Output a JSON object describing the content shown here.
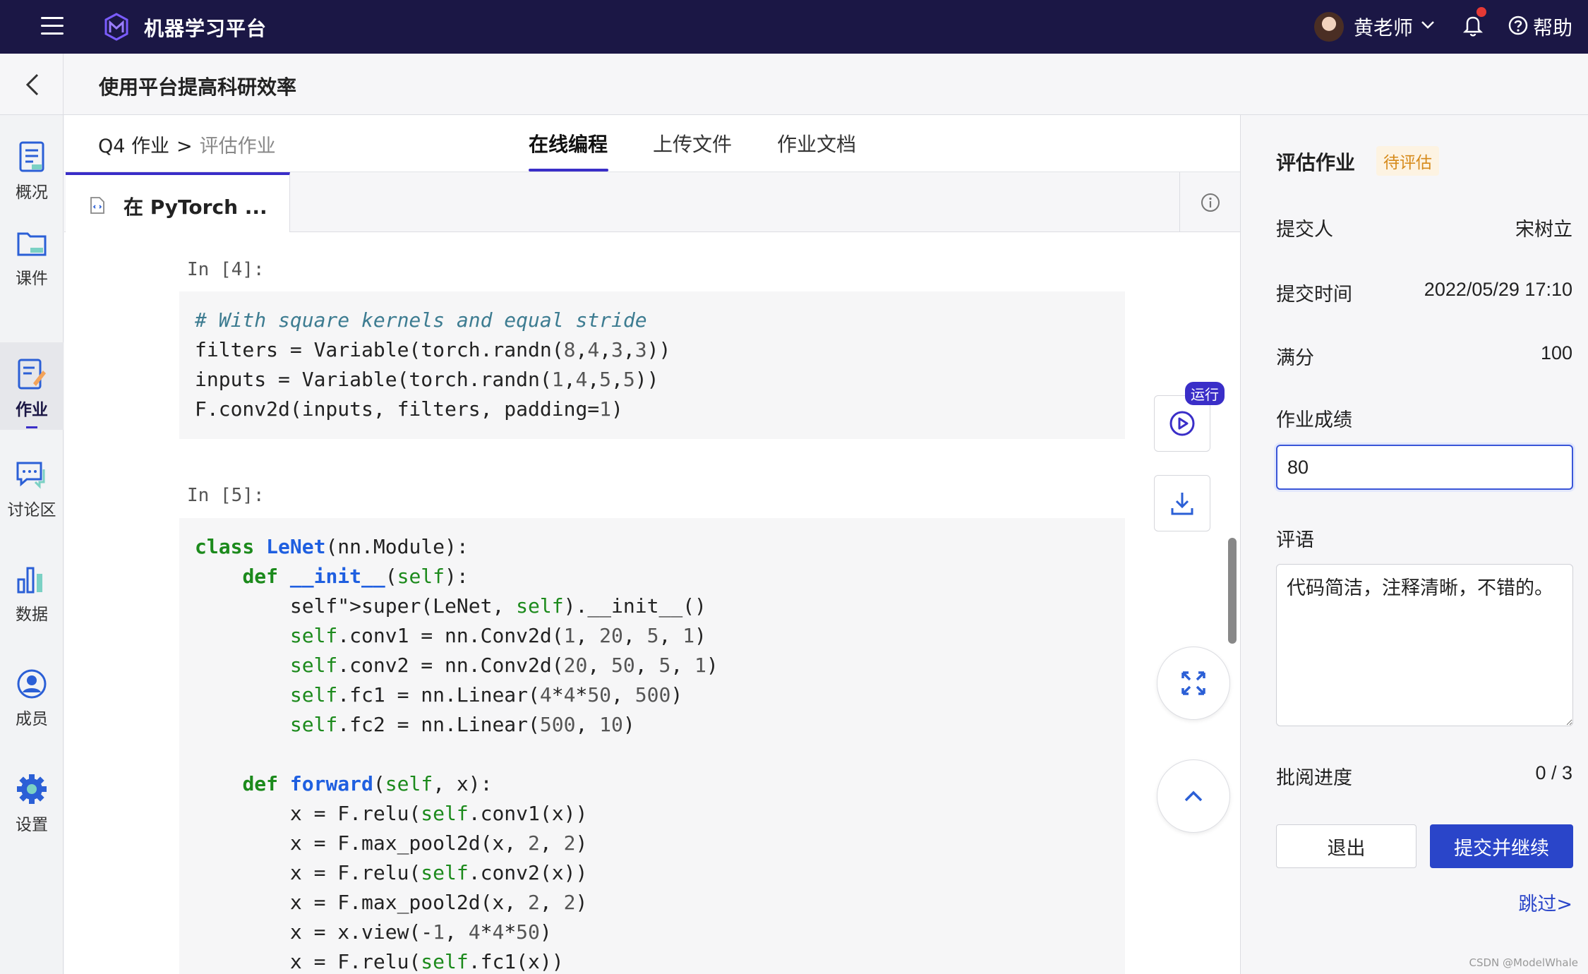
{
  "topbar": {
    "app_title": "机器学习平台",
    "user_name": "黄老师",
    "help_label": "帮助"
  },
  "header": {
    "page_title": "使用平台提高科研效率"
  },
  "sidebar": {
    "items": [
      {
        "label": "概况",
        "icon": "overview-icon"
      },
      {
        "label": "课件",
        "icon": "folder-icon"
      },
      {
        "label": "作业",
        "icon": "assignment-icon",
        "active": true
      },
      {
        "label": "讨论区",
        "icon": "discussion-icon"
      },
      {
        "label": "数据",
        "icon": "data-chart-icon"
      },
      {
        "label": "成员",
        "icon": "member-icon"
      },
      {
        "label": "设置",
        "icon": "gear-icon"
      }
    ]
  },
  "breadcrumb": {
    "parent": "Q4 作业",
    "separator": ">",
    "current": "评估作业"
  },
  "tabs": [
    {
      "label": "在线编程",
      "active": true
    },
    {
      "label": "上传文件"
    },
    {
      "label": "作业文档"
    }
  ],
  "file_tab": {
    "name": "在 PyTorch ..."
  },
  "notebook": {
    "cells": [
      {
        "prompt": "In [4]:",
        "lines": [
          "# With square kernels and equal stride",
          "filters = Variable(torch.randn(8,4,3,3))",
          "inputs = Variable(torch.randn(1,4,5,5))",
          "F.conv2d(inputs, filters, padding=1)"
        ]
      },
      {
        "prompt": "In [5]:",
        "lines": [
          "class LeNet(nn.Module):",
          "    def __init__(self):",
          "        super(LeNet, self).__init__()",
          "        self.conv1 = nn.Conv2d(1, 20, 5, 1)",
          "        self.conv2 = nn.Conv2d(20, 50, 5, 1)",
          "        self.fc1 = nn.Linear(4*4*50, 500)",
          "        self.fc2 = nn.Linear(500, 10)",
          "",
          "    def forward(self, x):",
          "        x = F.relu(self.conv1(x))",
          "        x = F.max_pool2d(x, 2, 2)",
          "        x = F.relu(self.conv2(x))",
          "        x = F.max_pool2d(x, 2, 2)",
          "        x = x.view(-1, 4*4*50)",
          "        x = F.relu(self.fc1(x))"
        ]
      }
    ],
    "run_badge": "运行"
  },
  "panel": {
    "title": "评估作业",
    "status": "待评估",
    "submitter_label": "提交人",
    "submitter": "宋树立",
    "submit_time_label": "提交时间",
    "submit_time": "2022/05/29 17:10",
    "full_score_label": "满分",
    "full_score": "100",
    "grade_label": "作业成绩",
    "grade_value": "80",
    "comment_label": "评语",
    "comment_value": "代码简洁，注释清晰，不错的。",
    "progress_label": "批阅进度",
    "progress": "0 / 3",
    "exit_label": "退出",
    "submit_label": "提交并继续",
    "skip_label": "跳过>"
  },
  "watermark": "CSDN @ModelWhale",
  "colors": {
    "topbar": "#1b1745",
    "accent": "#3a2ec8",
    "primary_button": "#2a45c9",
    "status_pending": "#d68a1a"
  }
}
